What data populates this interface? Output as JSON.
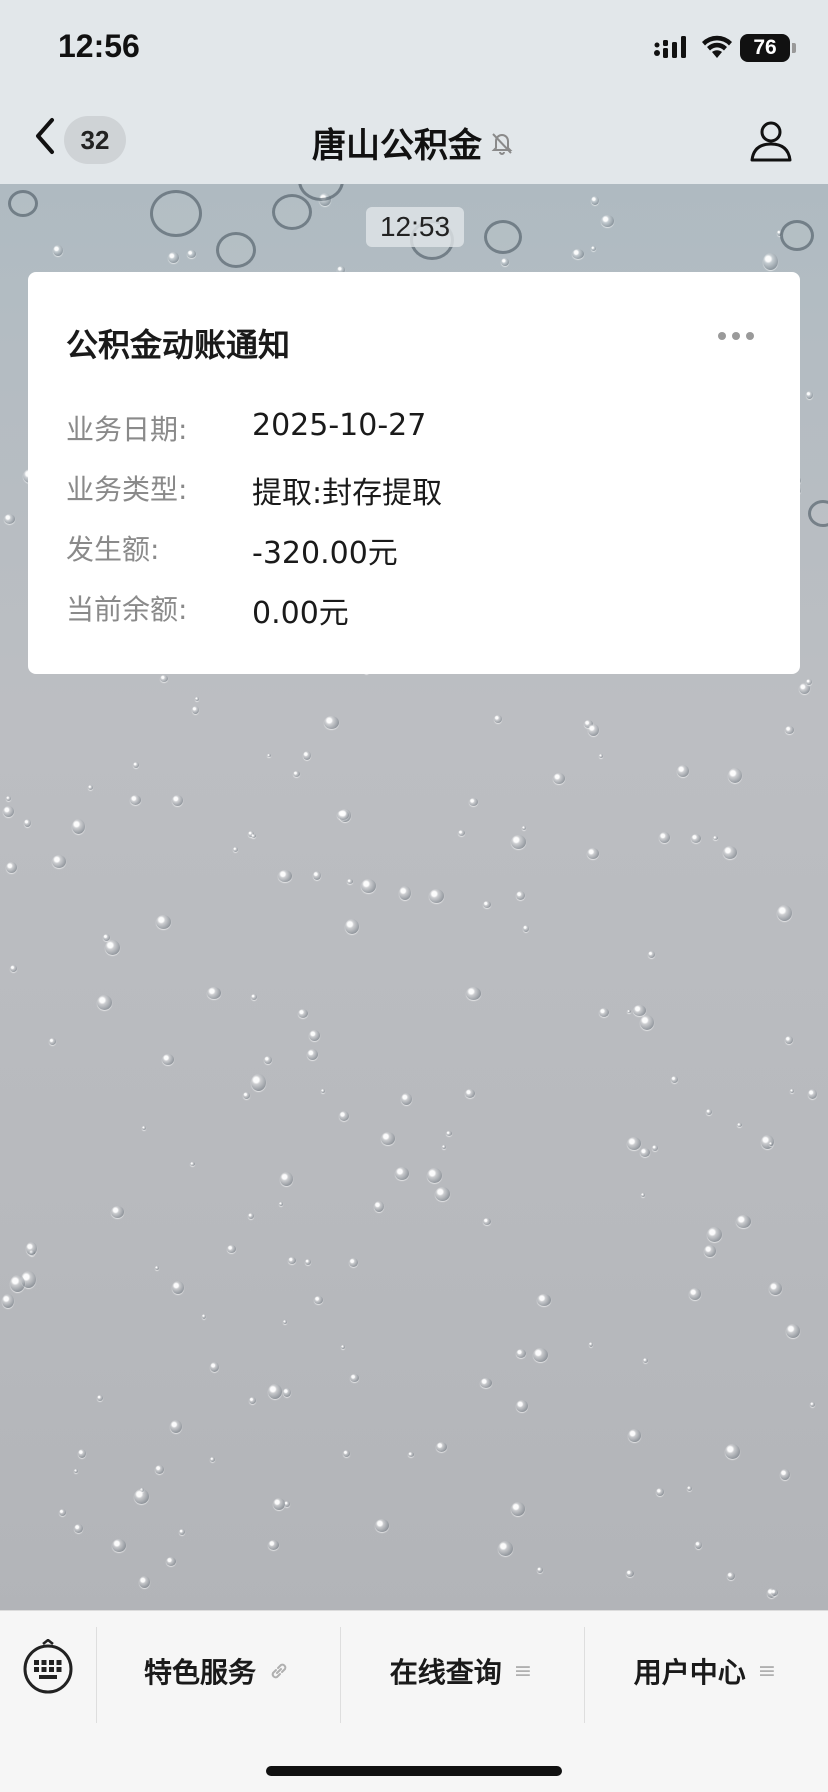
{
  "status_bar": {
    "time": "12:56",
    "battery": "76"
  },
  "nav": {
    "unread_count": "32",
    "title": "唐山公积金",
    "icons": [
      "back-icon",
      "mute-bell-icon",
      "profile-icon"
    ]
  },
  "message": {
    "timestamp": "12:53",
    "card": {
      "title": "公积金动账通知",
      "rows": [
        {
          "label": "业务日期:",
          "value": "2025-10-27"
        },
        {
          "label": "业务类型:",
          "value": "提取:封存提取"
        },
        {
          "label": "发生额:",
          "value": "-320.00元"
        },
        {
          "label": "当前余额:",
          "value": "0.00元"
        }
      ]
    }
  },
  "bottom_menu": {
    "items": [
      {
        "label": "特色服务",
        "icon": "link-icon"
      },
      {
        "label": "在线查询",
        "icon": "menu-lines-icon"
      },
      {
        "label": "用户中心",
        "icon": "menu-lines-icon"
      }
    ]
  },
  "colors": {
    "bar_bg": "#e2e7ea",
    "card_bg": "#ffffff",
    "label_gray": "#8a8a8a"
  }
}
